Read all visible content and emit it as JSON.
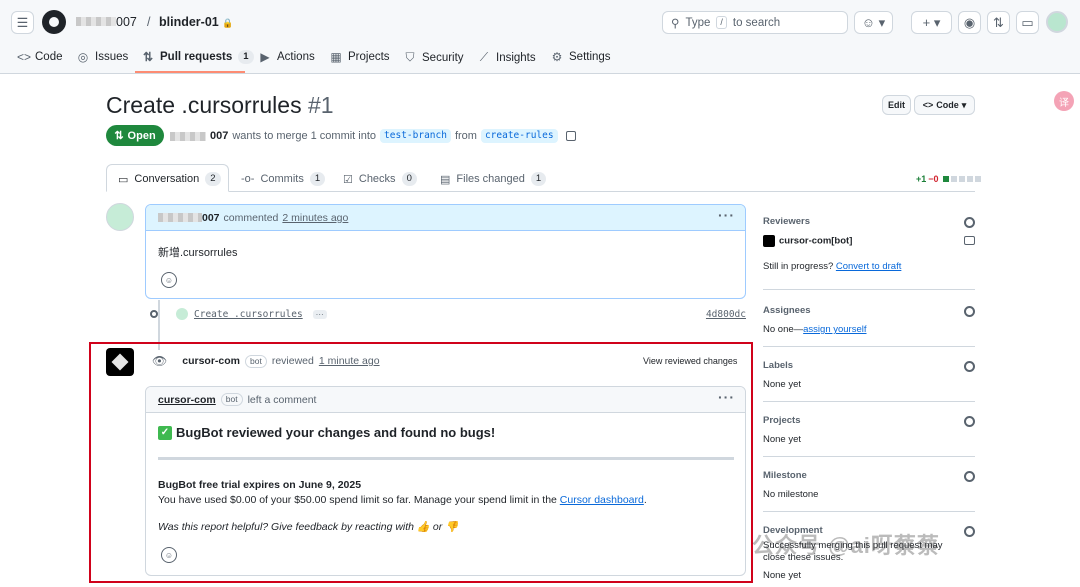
{
  "topbar": {
    "owner": "007",
    "separator": "/",
    "repo": "blinder-01",
    "search_placeholder_prefix": "Type",
    "search_key": "/",
    "search_placeholder_suffix": "to search"
  },
  "nav": {
    "code": "Code",
    "issues": "Issues",
    "pull_requests": "Pull requests",
    "pull_requests_count": "1",
    "actions": "Actions",
    "projects": "Projects",
    "security": "Security",
    "insights": "Insights",
    "settings": "Settings"
  },
  "pr": {
    "title": "Create .cursorrules",
    "number": "#1",
    "edit_label": "Edit",
    "code_label": "Code",
    "status": "Open",
    "author_suffix": "007",
    "merge_text": "wants to merge 1 commit into",
    "base_branch": "test-branch",
    "from_text": "from",
    "head_branch": "create-rules"
  },
  "tabs": {
    "conversation": "Conversation",
    "conversation_count": "2",
    "commits": "Commits",
    "commits_count": "1",
    "checks": "Checks",
    "checks_count": "0",
    "files_changed": "Files changed",
    "files_changed_count": "1",
    "additions": "+1",
    "deletions": "−0"
  },
  "comment": {
    "author_suffix": "007",
    "action": "commented",
    "time": "2 minutes ago",
    "body": "新增.cursorrules"
  },
  "commit": {
    "message": "Create .cursorrules",
    "ellipsis": "···",
    "sha": "4d800dc"
  },
  "review": {
    "author": "cursor-com",
    "bot_label": "bot",
    "action": "reviewed",
    "time": "1 minute ago",
    "view_changes": "View reviewed changes",
    "box_author": "cursor-com",
    "box_action": "left a comment",
    "title": "BugBot reviewed your changes and found no bugs!",
    "trial_title": "BugBot free trial expires on June 9, 2025",
    "trial_text_prefix": "You have used $0.00 of your $50.00 spend limit so far. Manage your spend limit in the",
    "trial_link": "Cursor dashboard",
    "trial_text_suffix": ".",
    "feedback": "Was this report helpful? Give feedback by reacting with 👍 or 👎"
  },
  "sidebar": {
    "reviewers_title": "Reviewers",
    "reviewer_name": "cursor-com[bot]",
    "in_progress": "Still in progress?",
    "convert_draft": "Convert to draft",
    "assignees_title": "Assignees",
    "assignees_none": "No one—",
    "assign_yourself": "assign yourself",
    "labels_title": "Labels",
    "labels_val": "None yet",
    "projects_title": "Projects",
    "projects_val": "None yet",
    "milestone_title": "Milestone",
    "milestone_val": "No milestone",
    "development_title": "Development",
    "development_val": "Successfully merging this pull request may close these issues.",
    "development_val2": "None yet"
  },
  "watermark": "公众号 @ai呀蔡蔡"
}
